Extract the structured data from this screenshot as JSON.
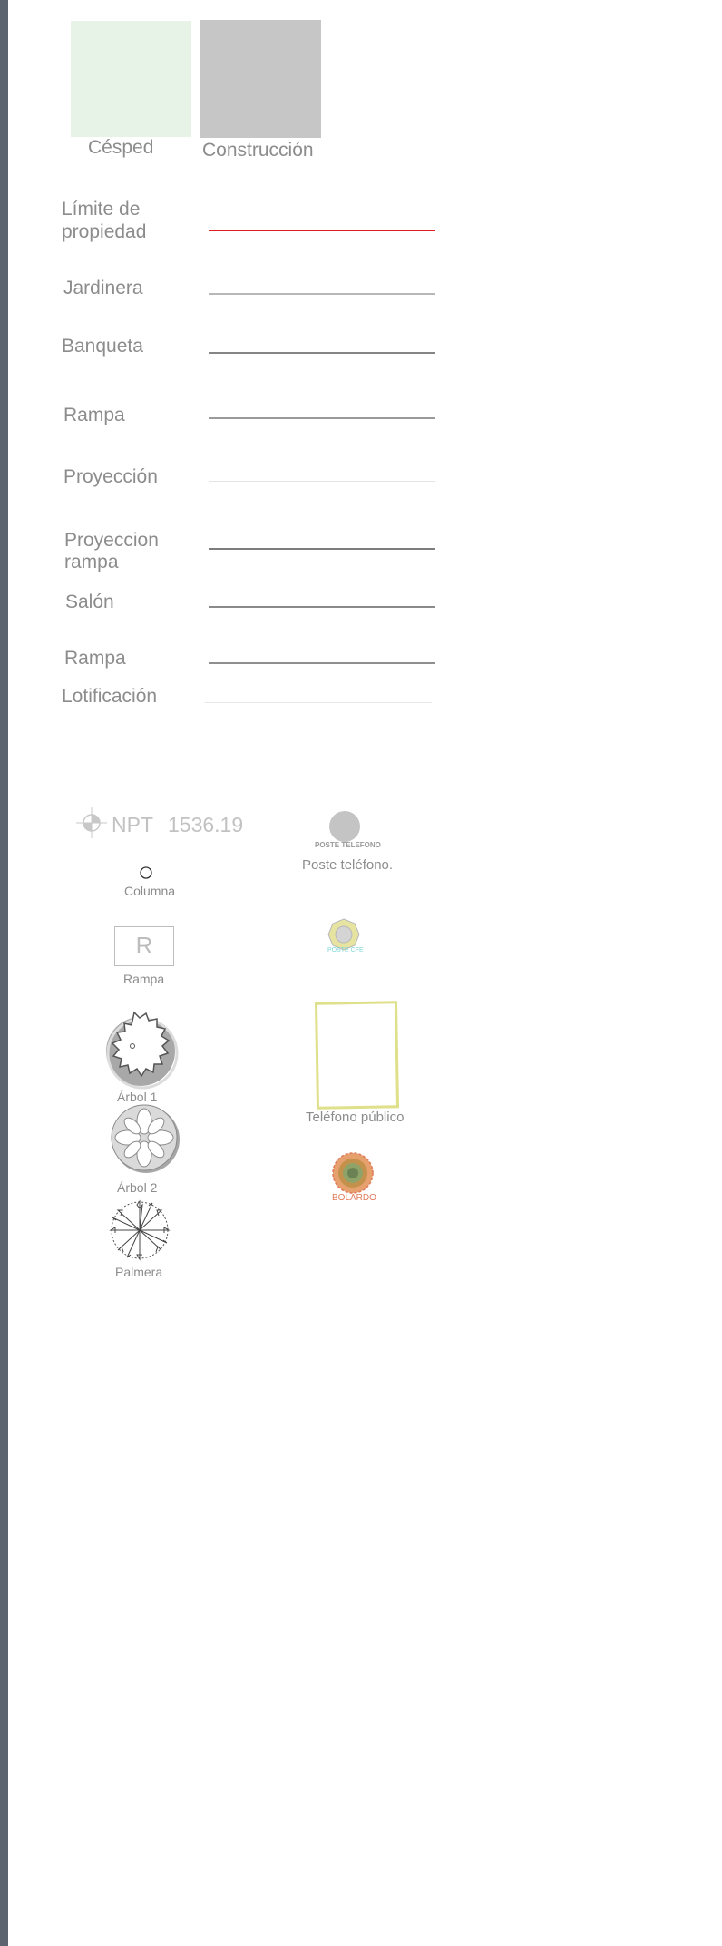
{
  "swatches": {
    "cesped": {
      "label": "Césped",
      "color": "#e8f3e8"
    },
    "construccion": {
      "label": "Construcción",
      "color": "#c6c6c6"
    }
  },
  "lines": [
    {
      "label": "Límite de\npropiedad",
      "color": "#e02020"
    },
    {
      "label": "Jardinera",
      "color": "#b8b8b8"
    },
    {
      "label": "Banqueta",
      "color": "#858585"
    },
    {
      "label": "Rampa",
      "color": "#9a9a9a"
    },
    {
      "label": "Proyección",
      "color": "#e4e4e4"
    },
    {
      "label": "Proyeccion\nrampa",
      "color": "#7d7d7d"
    },
    {
      "label": "Salón",
      "color": "#8a8a8a"
    },
    {
      "label": "Rampa",
      "color": "#8f8f8f"
    },
    {
      "label": "Lotificación",
      "color": "#e6e6e6"
    }
  ],
  "symbols": {
    "npt": {
      "prefix": "NPT",
      "value": "1536.19"
    },
    "poste_telefono": {
      "caption": "POSTE TELEFONO",
      "label": "Poste teléfono."
    },
    "columna": {
      "label": "Columna"
    },
    "rampa": {
      "letter": "R",
      "label": "Rampa"
    },
    "poste_cfe": {
      "caption": "POSTE CFE"
    },
    "arbol1": {
      "label": "Árbol 1"
    },
    "telefono_publico": {
      "label": "Teléfono público"
    },
    "arbol2": {
      "label": "Árbol 2"
    },
    "bolardo": {
      "caption": "BOLARDO"
    },
    "palmera": {
      "label": "Palmera"
    }
  },
  "colors": {
    "sidebar": "#5c6470",
    "telefono_publico_border": "#dfe08a",
    "poste_cfe_fill": "#e6e4a0",
    "poste_cfe_caption": "#7fd6d6",
    "bolardo_caption": "#e07a5a"
  }
}
